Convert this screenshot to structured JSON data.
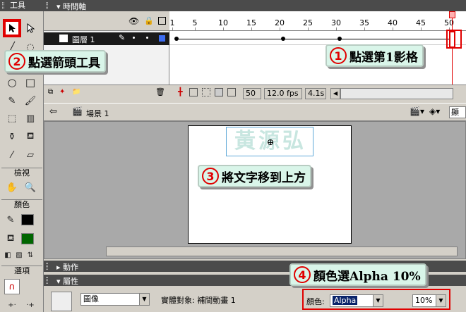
{
  "toolbox": {
    "title": "工具",
    "section_view": "檢視",
    "section_colors": "顏色",
    "section_options": "選項",
    "stroke_color": "#000000",
    "fill_color": "#006600"
  },
  "timeline": {
    "title": "時間軸",
    "layer_name": "圖層 1",
    "ruler_labels": [
      "1",
      "5",
      "10",
      "15",
      "20",
      "25",
      "30",
      "35",
      "40",
      "45",
      "50"
    ],
    "current_frame": "50",
    "frame_rate": "12.0 fps",
    "elapsed": "4.1s"
  },
  "scene": {
    "name": "場景 1",
    "display_label": "顯示"
  },
  "stage": {
    "text": "黃源弘"
  },
  "panels": {
    "actions": "動作",
    "properties": "屬性"
  },
  "properties": {
    "symbol_type": "圖像",
    "instance_label": "實體對象: 補間動畫 1",
    "color_label": "顏色:",
    "color_mode": "Alpha",
    "alpha_value": "10%"
  },
  "callouts": {
    "step1": {
      "num": "1",
      "text": "點選第1影格"
    },
    "step2": {
      "num": "2",
      "text": "點選箭頭工具"
    },
    "step3": {
      "num": "3",
      "text": "將文字移到上方"
    },
    "step4": {
      "num": "4",
      "text": "顏色選Alpha 10%"
    }
  }
}
